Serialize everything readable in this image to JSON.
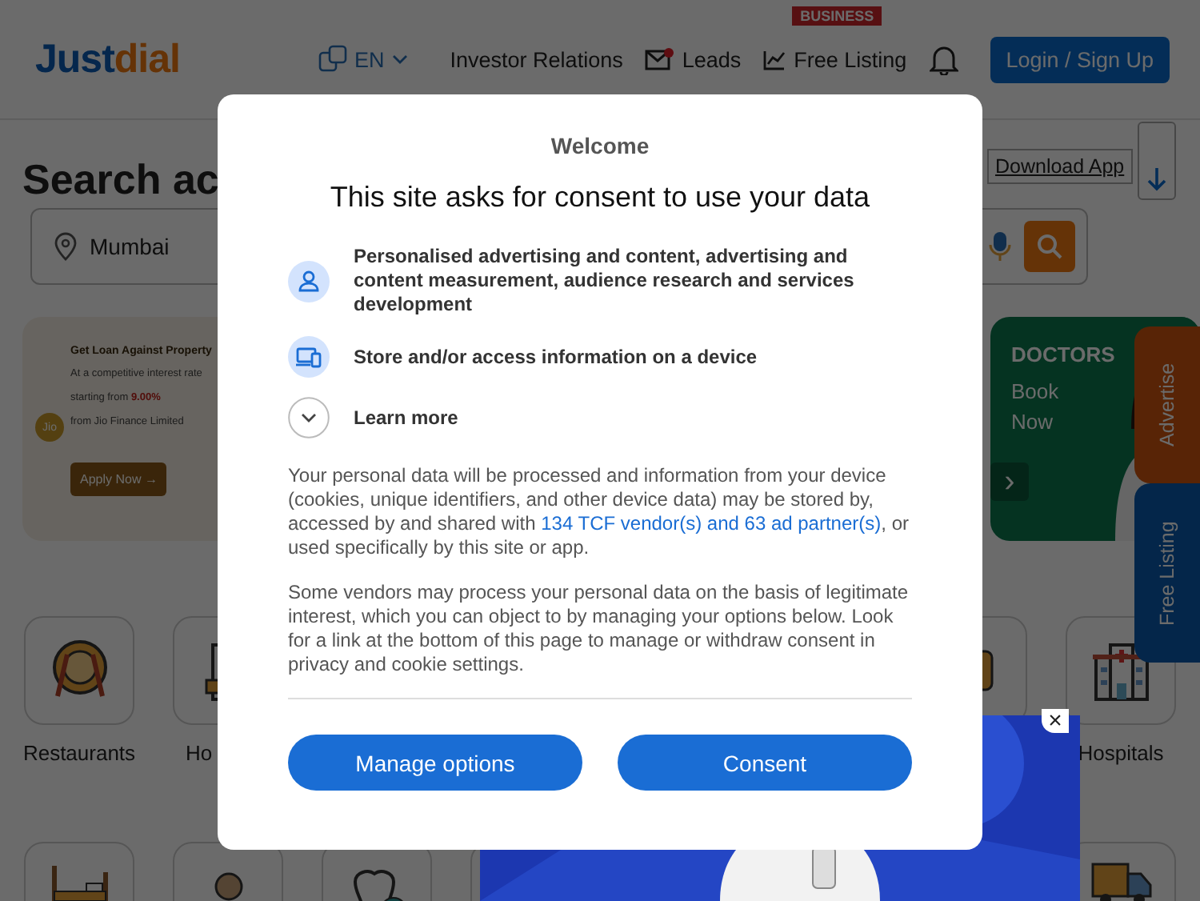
{
  "header": {
    "logo": {
      "part_1": "Just",
      "part_2": "dial"
    },
    "language": "EN",
    "nav": [
      {
        "kind": "text",
        "label": "Investor Relations"
      },
      {
        "kind": "leads",
        "label": "Leads"
      },
      {
        "kind": "listing",
        "label": "Free Listing",
        "badge": "BUSINESS"
      }
    ],
    "login_button": "Login / Sign Up"
  },
  "search": {
    "heading": "Search ac",
    "location": "Mumbai",
    "download_app": "Download App"
  },
  "banners": [
    {
      "kind": "loan",
      "title": "Get Loan Against Property",
      "line_1": "At a competitive interest rate",
      "line_2": "starting from",
      "rate": "9.00%",
      "line_3": "from Jio Finance Limited",
      "brand": "Jio",
      "button": "Apply Now →"
    },
    {
      "kind": "doctors",
      "title": "DOCTORS",
      "line_1": "Book",
      "line_2": "Now",
      "arrow": "›"
    }
  ],
  "side_tabs": [
    {
      "kind": "advertise",
      "label": "Advertise"
    },
    {
      "kind": "listing",
      "label": "Free Listing"
    }
  ],
  "category_rows": [
    {
      "left": [
        {
          "kind": "restaurant",
          "label": "Restaurants",
          "cut_off": false
        },
        {
          "kind": "hotel",
          "label": "Ho",
          "cut_off": true
        }
      ],
      "right": [
        {
          "kind": "generic"
        },
        {
          "kind": "hospital",
          "label": "Hospitals",
          "cut_off": false
        }
      ]
    },
    {
      "left": [
        {
          "kind": "bed"
        },
        {
          "kind": "person"
        },
        {
          "kind": "dental"
        },
        {
          "kind": "blank"
        }
      ],
      "right": [
        {
          "kind": "truck"
        }
      ]
    }
  ],
  "ad": {
    "kind": "picture",
    "close": "×"
  },
  "consent": {
    "title": "Welcome",
    "heading": "This site asks for consent to use your data",
    "purposes": [
      {
        "kind": "person",
        "text": "Personalised advertising and content, advertising and content measurement, audience research and services development"
      },
      {
        "kind": "device",
        "text": "Store and/or access information on a device"
      },
      {
        "kind": "expand",
        "text": "Learn more",
        "expanded": false
      }
    ],
    "paragraph_1": {
      "before": "Your personal data will be processed and information from your device (cookies, unique identifiers, and other device data) may be stored by, accessed by and shared with",
      "link": "134 TCF vendor(s) and 63 ad partner(s)",
      "after": ", or used specifically by this site or app."
    },
    "paragraph_2": "Some vendors may process your personal data on the basis of legitimate interest, which you can object to by managing your options below. Look for a link at the bottom of this page to manage or withdraw consent in privacy and cookie settings.",
    "buttons": [
      "Manage options",
      "Consent"
    ]
  }
}
